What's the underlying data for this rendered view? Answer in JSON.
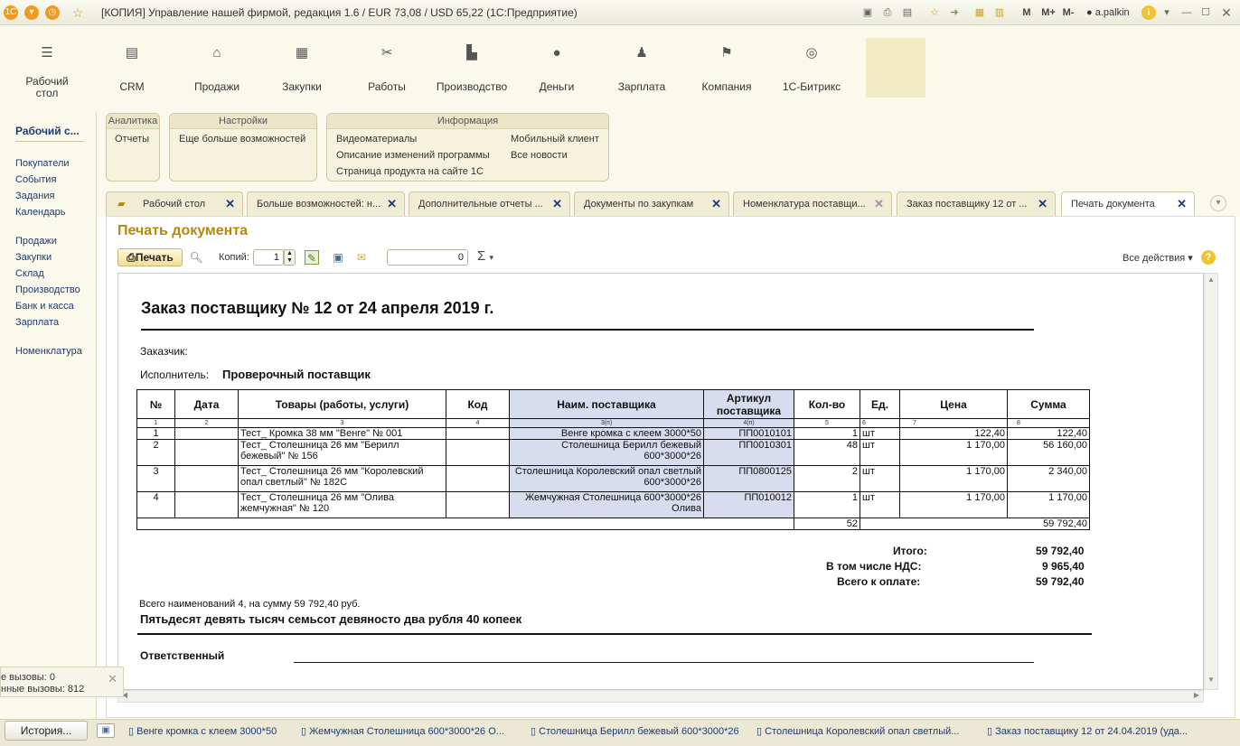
{
  "window": {
    "title": "[КОПИЯ] Управление нашей фирмой, редакция 1.6 / EUR 73,08 / USD 65,22  (1С:Предприятие)",
    "user": "a.palkin",
    "memory_buttons": [
      "M",
      "M+",
      "M-"
    ]
  },
  "sections": [
    {
      "label": "Рабочий стол",
      "icon": "menu-icon"
    },
    {
      "label": "CRM",
      "icon": "crm-icon"
    },
    {
      "label": "Продажи",
      "icon": "basket-icon"
    },
    {
      "label": "Закупки",
      "icon": "cart-icon"
    },
    {
      "label": "Работы",
      "icon": "tools-icon"
    },
    {
      "label": "Производство",
      "icon": "factory-icon"
    },
    {
      "label": "Деньги",
      "icon": "money-icon"
    },
    {
      "label": "Зарплата",
      "icon": "people-icon"
    },
    {
      "label": "Компания",
      "icon": "flag-icon"
    },
    {
      "label": "1С-Битрикс",
      "icon": "bitrix-icon"
    }
  ],
  "left_panel": {
    "title": "Рабочий с...",
    "items": [
      "Покупатели",
      "События",
      "Задания",
      "Календарь",
      "Продажи",
      "Закупки",
      "Склад",
      "Производство",
      "Банк и касса",
      "Зарплата",
      "Номенклатура"
    ]
  },
  "groups": {
    "analytics": {
      "title": "Аналитика",
      "items": [
        "Отчеты"
      ]
    },
    "settings": {
      "title": "Настройки",
      "items": [
        "Еще больше возможностей"
      ]
    },
    "info": {
      "title": "Информация",
      "items": [
        "Видеоматериалы",
        "Описание изменений программы",
        "Страница продукта на сайте 1С",
        "Мобильный клиент",
        "Все новости"
      ]
    }
  },
  "tabs": [
    "Рабочий стол",
    "Больше возможностей: н...",
    "Дополнительные отчеты ...",
    "Документы по закупкам",
    "Номенклатура поставщи...",
    "Заказ поставщику 12 от ...",
    "Печать документа"
  ],
  "form": {
    "title": "Печать документа",
    "print_label": "Печать",
    "copies_label": "Копий:",
    "copies_value": "1",
    "sum_value": "0",
    "all_actions": "Все действия ▾"
  },
  "document": {
    "title": "Заказ поставщику № 12 от 24 апреля 2019 г.",
    "customer_label": "Заказчик:",
    "customer_value": "",
    "supplier_label": "Исполнитель:",
    "supplier_value": "Проверочный поставщик",
    "columns": [
      "№",
      "Дата",
      "Товары (работы, услуги)",
      "Код",
      "Наим. поставщика",
      "Артикул поставщика",
      "Кол-во",
      "Ед.",
      "Цена",
      "Сумма"
    ],
    "column_numbers": [
      "1",
      "2",
      "3",
      "4",
      "3(п)",
      "4(п)",
      "5",
      "6",
      "7",
      "8"
    ],
    "rows": [
      {
        "n": "1",
        "date": "",
        "name": "Тест_ Кромка 38 мм \"Венге\" № 001",
        "code": "",
        "supplier_name": "Венге кромка с клеем 3000*50",
        "article": "ПП0010101",
        "qty": "1",
        "unit": "шт",
        "price": "122,40",
        "sum": "122,40"
      },
      {
        "n": "2",
        "date": "",
        "name": "Тест_ Столешница 26 мм \"Берилл бежевый\" № 156",
        "code": "",
        "supplier_name": "Столешница Берилл бежевый 600*3000*26",
        "article": "ПП0010301",
        "qty": "48",
        "unit": "шт",
        "price": "1 170,00",
        "sum": "56 160,00"
      },
      {
        "n": "3",
        "date": "",
        "name": "Тест_ Столешница 26 мм \"Королевский опал светлый\" № 182С",
        "code": "",
        "supplier_name": "Столешница Королевский опал светлый 600*3000*26",
        "article": "ПП0800125",
        "qty": "2",
        "unit": "шт",
        "price": "1 170,00",
        "sum": "2 340,00"
      },
      {
        "n": "4",
        "date": "",
        "name": "Тест_ Столешница 26 мм \"Олива жемчужная\" № 120",
        "code": "",
        "supplier_name": "Жемчужная Столешница 600*3000*26 Олива",
        "article": "ПП010012",
        "qty": "1",
        "unit": "шт",
        "price": "1 170,00",
        "sum": "1 170,00"
      }
    ],
    "total_qty": "52",
    "total_sum": "59 792,40",
    "totals": [
      {
        "label": "Итого:",
        "value": "59 792,40"
      },
      {
        "label": "В том числе НДС:",
        "value": "9 965,40"
      },
      {
        "label": "Всего к оплате:",
        "value": "59 792,40"
      }
    ],
    "summary_line": "Всего наименований 4, на сумму 59 792,40 руб.",
    "sum_in_words": "Пятьдесят девять тысяч семьсот девяносто два рубля 40 копеек",
    "responsible_label": "Ответственный"
  },
  "calls_popup": {
    "line1": "е вызовы: 0",
    "line2": "нные вызовы: 812"
  },
  "status_bar": {
    "history_label": "История...",
    "items": [
      "Венге кромка с клеем 3000*50",
      "Жемчужная Столешница 600*3000*26 О...",
      "Столешница Берилл бежевый  600*3000*26",
      "Столешница Королевский опал светлый...",
      "Заказ поставщику 12 от 24.04.2019 (уда..."
    ]
  }
}
